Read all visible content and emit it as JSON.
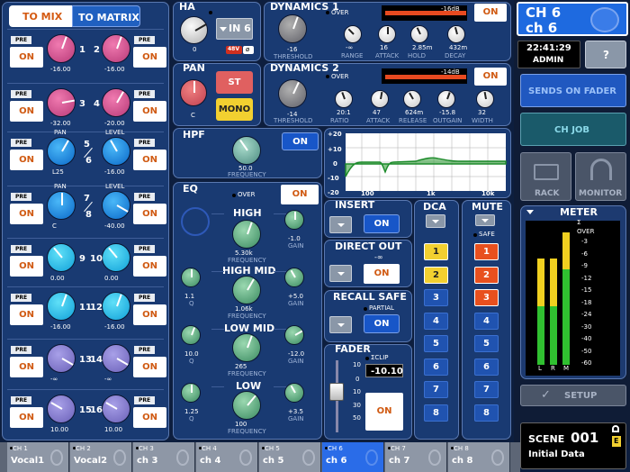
{
  "left": {
    "tab_mix": "TO MIX",
    "tab_matrix": "TO MATRIX",
    "pre": "PRE",
    "on": "ON",
    "pan": "PAN",
    "level": "LEVEL",
    "rows": [
      {
        "l": "-16.00",
        "n1": "1",
        "r": "-16.00",
        "n2": "2"
      },
      {
        "l": "-32.00",
        "n1": "3",
        "r": "-20.00",
        "n2": "4"
      },
      {
        "l": "L25",
        "n1": "5",
        "n1b": "6",
        "r": "-16.00"
      },
      {
        "l": "C",
        "n1": "7",
        "n1b": "8",
        "r": "-40.00"
      },
      {
        "l": "0.00",
        "n1": "9",
        "r": "0.00",
        "n2": "10"
      },
      {
        "l": "-16.00",
        "n1": "11",
        "r": "-16.00",
        "n2": "12"
      },
      {
        "l": "-∞",
        "n1": "13",
        "r": "-∞",
        "n2": "14"
      },
      {
        "l": "10.00",
        "n1": "15",
        "r": "10.00",
        "n2": "16"
      }
    ]
  },
  "ha": {
    "title": "HA",
    "val": "0",
    "in": "IN 6",
    "v48": "48V",
    "phi": "ø"
  },
  "pan": {
    "title": "PAN",
    "val": "C",
    "st": "ST",
    "mono": "MONO"
  },
  "hpf": {
    "title": "HPF",
    "on": "ON",
    "val": "50.0",
    "freq": "FREQUENCY"
  },
  "dyn1": {
    "title": "DYNAMICS 1",
    "over": "OVER",
    "db": "-16dB",
    "on": "ON",
    "thr": "-16",
    "thr_l": "THRESHOLD",
    "range": "-∞",
    "range_l": "RANGE",
    "att": "16",
    "att_l": "ATTACK",
    "hold": "2.85m",
    "hold_l": "HOLD",
    "decay": "432m",
    "decay_l": "DECAY"
  },
  "dyn2": {
    "title": "DYNAMICS 2",
    "over": "OVER",
    "db": "-14dB",
    "on": "ON",
    "thr": "-14",
    "thr_l": "THRESHOLD",
    "ratio": "20:1",
    "ratio_l": "RATIO",
    "att": "47",
    "att_l": "ATTACK",
    "rel": "624m",
    "rel_l": "RELEASE",
    "og": "-15.8",
    "og_l": "OUTGAIN",
    "width": "32",
    "width_l": "WIDTH"
  },
  "graph": {
    "t20": "+20",
    "t10": "+10",
    "t0": "0",
    "tm10": "-10",
    "tm20": "-20",
    "x100": "100",
    "x1k": "1k",
    "x10k": "10k"
  },
  "eq": {
    "title": "EQ",
    "over": "OVER",
    "on": "ON",
    "high": "HIGH",
    "high_f": "5.30k",
    "high_g": "-1.0",
    "hmid": "HIGH MID",
    "hmid_q": "1.1",
    "hmid_f": "1.06k",
    "hmid_g": "+5.0",
    "lmid": "LOW MID",
    "lmid_q": "10.0",
    "lmid_f": "265",
    "lmid_g": "-12.0",
    "low": "LOW",
    "low_q": "1.25",
    "low_f": "100",
    "low_g": "+3.5",
    "freq": "FREQUENCY",
    "gain": "GAIN",
    "q": "Q"
  },
  "insert": {
    "title": "INSERT",
    "on": "ON"
  },
  "direct": {
    "title": "DIRECT OUT",
    "val": "-∞",
    "on": "ON"
  },
  "recall": {
    "title": "RECALL SAFE",
    "partial": "PARTIAL",
    "on": "ON"
  },
  "fader": {
    "title": "FADER",
    "clip": "ΣCLIP",
    "val": "-10.10",
    "on": "ON",
    "s10": "10",
    "s0": "0",
    "s10b": "10",
    "s30": "30",
    "s50": "50"
  },
  "dca": {
    "title": "DCA",
    "items": [
      "1",
      "2",
      "3",
      "4",
      "5",
      "6",
      "7",
      "8"
    ]
  },
  "mute": {
    "title": "MUTE",
    "safe": "SAFE",
    "items": [
      "1",
      "2",
      "3",
      "4",
      "5",
      "6",
      "7",
      "8"
    ]
  },
  "right": {
    "ch": "CH 6",
    "chn": "ch 6",
    "time": "22:41:29",
    "user": "ADMIN",
    "help": "?",
    "sends": "SENDS ON FADER",
    "chjob": "CH JOB",
    "rack": "RACK",
    "monitor": "MONITOR",
    "meter": "METER",
    "sigma": "Σ",
    "over": "OVER",
    "scale": [
      "-3",
      "-6",
      "-9",
      "-12",
      "-15",
      "-18",
      "-24",
      "-30",
      "-40",
      "-50",
      "-60"
    ],
    "lrm": [
      "L",
      "R",
      "M"
    ],
    "setup": "SETUP",
    "scene": "SCENE",
    "scene_no": "001",
    "scene_name": "Initial Data",
    "e": "E"
  },
  "tabs": [
    {
      "c": "CH 1",
      "n": "Vocal1"
    },
    {
      "c": "CH 2",
      "n": "Vocal2"
    },
    {
      "c": "CH 3",
      "n": "ch 3"
    },
    {
      "c": "CH 4",
      "n": "ch 4"
    },
    {
      "c": "CH 5",
      "n": "ch 5"
    },
    {
      "c": "CH 6",
      "n": "ch 6"
    },
    {
      "c": "CH 7",
      "n": "ch 7"
    },
    {
      "c": "CH 8",
      "n": "ch 8"
    }
  ]
}
